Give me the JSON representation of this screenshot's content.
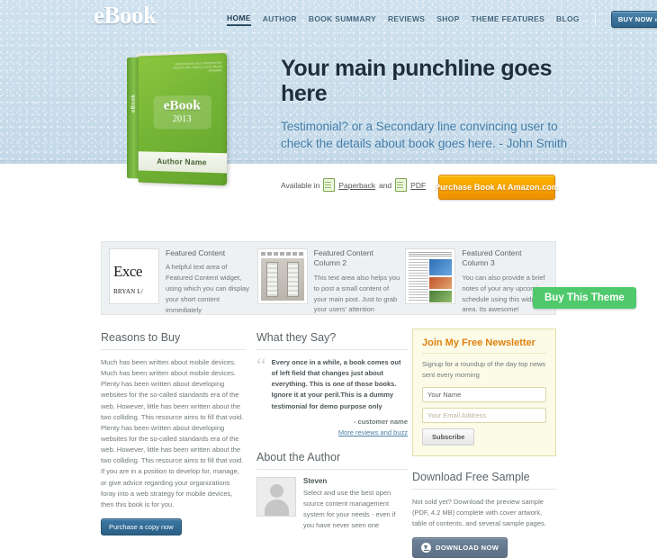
{
  "brand": {
    "logo": "eBook"
  },
  "nav": {
    "items": [
      {
        "label": "HOME",
        "active": true
      },
      {
        "label": "AUTHOR",
        "active": false
      },
      {
        "label": "BOOK SUMMARY",
        "active": false
      },
      {
        "label": "REVIEWS",
        "active": false
      },
      {
        "label": "SHOP",
        "active": false
      },
      {
        "label": "THEME FEATURES",
        "active": false
      },
      {
        "label": "BLOG",
        "active": false
      }
    ],
    "cta_label": "BUY NOW »"
  },
  "book_cover": {
    "top_line": "multipurpose and refreshed for anyone who wants a new eBook template",
    "spine": "eBook",
    "title": "eBook",
    "year": "2013",
    "author": "Author Name"
  },
  "hero": {
    "punchline": "Your main punchline goes here",
    "subline": "Testimonial? or a Secondary line convincing user to check the details about book goes here. - John Smith",
    "available_prefix": "Available in",
    "format_paperback": "Paperback",
    "available_conjunction": "and",
    "format_pdf": "PDF",
    "purchase_button": "Purchase Book At Amazon.com"
  },
  "featured": {
    "columns": [
      {
        "title": "Featured Content",
        "text": "A helpful text area of Featured Content widget, using which you can display your short content immediately",
        "thumb": "book-cover-thumb"
      },
      {
        "title": "Featured Content Column 2",
        "text": "This text area also helps you to post a small content of your main post. Just to grab your users' attention",
        "thumb": "remote-controls-thumb"
      },
      {
        "title": "Featured Content Column 3",
        "text": "You can also provide a brief notes of your any upcoming schedule using this widget area. Its awesome!",
        "thumb": "magazine-page-thumb"
      }
    ]
  },
  "buy_theme": {
    "label": "Buy This Theme"
  },
  "reasons": {
    "title": "Reasons to Buy",
    "text": "Much has been written about mobile devices. Much has been written about mobile devices. Plenty has been written about developing websites for the so-called standards era of the web. However, little has been written about the two colliding. This resource aims to fill that void. Plenty has been written about developing websites for the so-called standards era of the web. However, little has been written about the two colliding. This resource aims to fill that void. If you are in a position to develop for, manage, or give advice regarding your organizations foray into a web strategy for mobile devices, then this book is for you.",
    "button": "Purchase a copy now"
  },
  "testimonials": {
    "title": "What they Say?",
    "quote_mark": "“",
    "quote": "Every once in a while, a book comes out of left field that changes just about everything. This is one of those books. Ignore it at your peril.This is a dummy testimonial for demo purpose only",
    "attribution": "- customer name",
    "more_link": "More reviews and buzz"
  },
  "author_section": {
    "title": "About the Author",
    "name": "Steven",
    "bio": "Select and use the best open source content management system for your needs - even if you have never seen one"
  },
  "newsletter": {
    "title": "Join My Free Newsletter",
    "description": "Signup for a roundup of the day top news sent every morning",
    "name_value": "Your Name",
    "name_placeholder": "Your Name",
    "email_placeholder": "Your Email Address",
    "subscribe_label": "Subscribe"
  },
  "download": {
    "title": "Download Free Sample",
    "description": "Not sold yet? Download the preview sample (PDF, 4.2 MB) complete with cover artwork, table of contents, and several sample pages.",
    "button": "DOWNLOAD NOW"
  },
  "colors": {
    "hero_bg": "#c8dcea",
    "nav_link": "#41647d",
    "nav_cta": "#2d6389",
    "punchline": "#1f2f3a",
    "subline": "#3f7ba8",
    "amazon_orange": "#ef8f00",
    "theme_green": "#4fc96c",
    "newsletter_title": "#e0800e",
    "newsletter_bg": "#fbfbe8",
    "book_green": "#76b636"
  }
}
